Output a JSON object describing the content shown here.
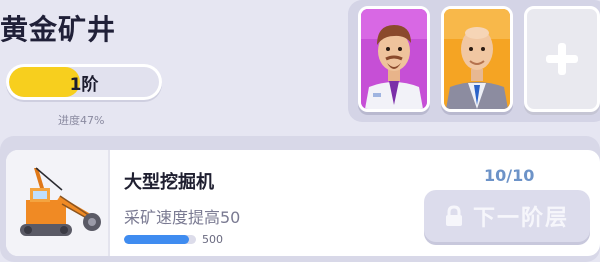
{
  "header": {
    "title": "黄金矿井",
    "tier_label": "1阶",
    "progress_text": "进度47%",
    "progress_fraction": 0.47
  },
  "managers": {
    "cards": [
      {
        "name": "manager-1",
        "bg": "#c64fd6"
      },
      {
        "name": "manager-2",
        "bg": "#f5a423"
      }
    ],
    "add_icon": "plus-icon"
  },
  "upgrade_item": {
    "name": "大型挖掘机",
    "description": "采矿速度提高50",
    "cost": "500",
    "count": "10/10",
    "cost_progress_fraction": 0.9,
    "next_button_label": "下一阶层",
    "next_button_icon": "lock-icon"
  },
  "colors": {
    "accent_yellow": "#f7cf1e",
    "accent_blue": "#3f8cf0",
    "count_blue": "#6d93c8"
  }
}
